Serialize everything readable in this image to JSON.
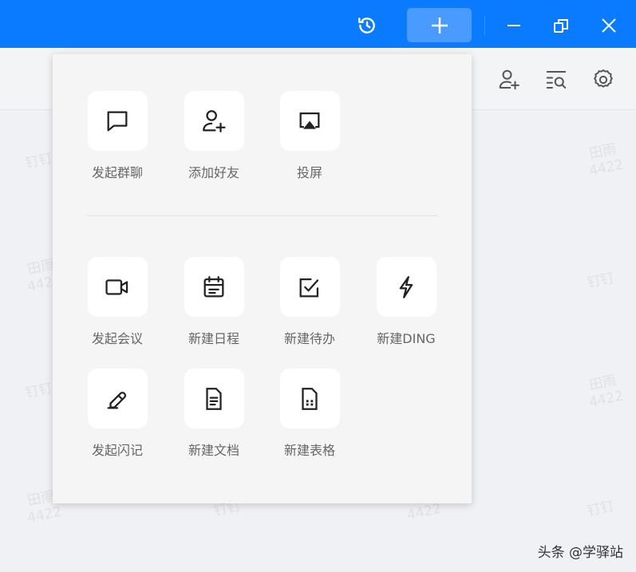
{
  "titlebar": {
    "icons": [
      "history-icon",
      "plus-icon",
      "minimize-icon",
      "restore-icon",
      "close-icon"
    ],
    "accent": "#0a7bff"
  },
  "toolbar": {
    "icons": [
      "add-contact-icon",
      "search-list-icon",
      "settings-icon"
    ]
  },
  "watermark": {
    "name": "田雨",
    "number": "4422",
    "app": "钉钉"
  },
  "popup": {
    "row1": [
      {
        "label": "发起群聊",
        "icon": "chat-icon"
      },
      {
        "label": "添加好友",
        "icon": "add-friend-icon"
      },
      {
        "label": "投屏",
        "icon": "screen-cast-icon"
      }
    ],
    "row2": [
      {
        "label": "发起会议",
        "icon": "video-icon"
      },
      {
        "label": "新建日程",
        "icon": "calendar-icon"
      },
      {
        "label": "新建待办",
        "icon": "todo-icon"
      },
      {
        "label": "新建DING",
        "icon": "lightning-icon"
      }
    ],
    "row3": [
      {
        "label": "发起闪记",
        "icon": "pen-icon"
      },
      {
        "label": "新建文档",
        "icon": "doc-icon"
      },
      {
        "label": "新建表格",
        "icon": "sheet-icon"
      }
    ]
  },
  "credit": "头条 @学驿站"
}
